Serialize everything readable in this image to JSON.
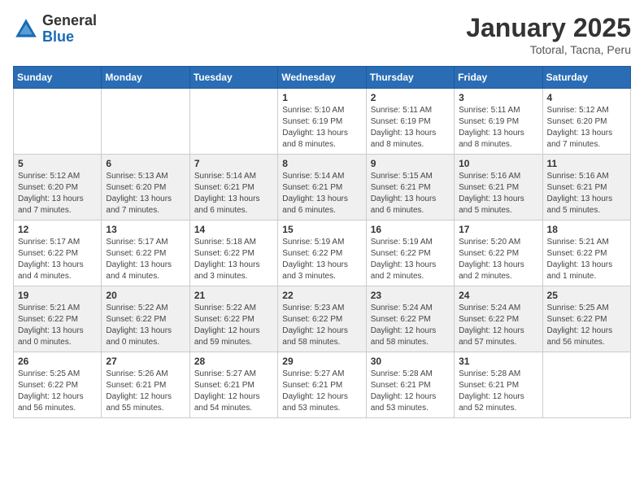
{
  "header": {
    "logo_general": "General",
    "logo_blue": "Blue",
    "title": "January 2025",
    "location": "Totoral, Tacna, Peru"
  },
  "calendar": {
    "days_of_week": [
      "Sunday",
      "Monday",
      "Tuesday",
      "Wednesday",
      "Thursday",
      "Friday",
      "Saturday"
    ],
    "weeks": [
      [
        {
          "day": "",
          "info": ""
        },
        {
          "day": "",
          "info": ""
        },
        {
          "day": "",
          "info": ""
        },
        {
          "day": "1",
          "info": "Sunrise: 5:10 AM\nSunset: 6:19 PM\nDaylight: 13 hours and 8 minutes."
        },
        {
          "day": "2",
          "info": "Sunrise: 5:11 AM\nSunset: 6:19 PM\nDaylight: 13 hours and 8 minutes."
        },
        {
          "day": "3",
          "info": "Sunrise: 5:11 AM\nSunset: 6:19 PM\nDaylight: 13 hours and 8 minutes."
        },
        {
          "day": "4",
          "info": "Sunrise: 5:12 AM\nSunset: 6:20 PM\nDaylight: 13 hours and 7 minutes."
        }
      ],
      [
        {
          "day": "5",
          "info": "Sunrise: 5:12 AM\nSunset: 6:20 PM\nDaylight: 13 hours and 7 minutes."
        },
        {
          "day": "6",
          "info": "Sunrise: 5:13 AM\nSunset: 6:20 PM\nDaylight: 13 hours and 7 minutes."
        },
        {
          "day": "7",
          "info": "Sunrise: 5:14 AM\nSunset: 6:21 PM\nDaylight: 13 hours and 6 minutes."
        },
        {
          "day": "8",
          "info": "Sunrise: 5:14 AM\nSunset: 6:21 PM\nDaylight: 13 hours and 6 minutes."
        },
        {
          "day": "9",
          "info": "Sunrise: 5:15 AM\nSunset: 6:21 PM\nDaylight: 13 hours and 6 minutes."
        },
        {
          "day": "10",
          "info": "Sunrise: 5:16 AM\nSunset: 6:21 PM\nDaylight: 13 hours and 5 minutes."
        },
        {
          "day": "11",
          "info": "Sunrise: 5:16 AM\nSunset: 6:21 PM\nDaylight: 13 hours and 5 minutes."
        }
      ],
      [
        {
          "day": "12",
          "info": "Sunrise: 5:17 AM\nSunset: 6:22 PM\nDaylight: 13 hours and 4 minutes."
        },
        {
          "day": "13",
          "info": "Sunrise: 5:17 AM\nSunset: 6:22 PM\nDaylight: 13 hours and 4 minutes."
        },
        {
          "day": "14",
          "info": "Sunrise: 5:18 AM\nSunset: 6:22 PM\nDaylight: 13 hours and 3 minutes."
        },
        {
          "day": "15",
          "info": "Sunrise: 5:19 AM\nSunset: 6:22 PM\nDaylight: 13 hours and 3 minutes."
        },
        {
          "day": "16",
          "info": "Sunrise: 5:19 AM\nSunset: 6:22 PM\nDaylight: 13 hours and 2 minutes."
        },
        {
          "day": "17",
          "info": "Sunrise: 5:20 AM\nSunset: 6:22 PM\nDaylight: 13 hours and 2 minutes."
        },
        {
          "day": "18",
          "info": "Sunrise: 5:21 AM\nSunset: 6:22 PM\nDaylight: 13 hours and 1 minute."
        }
      ],
      [
        {
          "day": "19",
          "info": "Sunrise: 5:21 AM\nSunset: 6:22 PM\nDaylight: 13 hours and 0 minutes."
        },
        {
          "day": "20",
          "info": "Sunrise: 5:22 AM\nSunset: 6:22 PM\nDaylight: 13 hours and 0 minutes."
        },
        {
          "day": "21",
          "info": "Sunrise: 5:22 AM\nSunset: 6:22 PM\nDaylight: 12 hours and 59 minutes."
        },
        {
          "day": "22",
          "info": "Sunrise: 5:23 AM\nSunset: 6:22 PM\nDaylight: 12 hours and 58 minutes."
        },
        {
          "day": "23",
          "info": "Sunrise: 5:24 AM\nSunset: 6:22 PM\nDaylight: 12 hours and 58 minutes."
        },
        {
          "day": "24",
          "info": "Sunrise: 5:24 AM\nSunset: 6:22 PM\nDaylight: 12 hours and 57 minutes."
        },
        {
          "day": "25",
          "info": "Sunrise: 5:25 AM\nSunset: 6:22 PM\nDaylight: 12 hours and 56 minutes."
        }
      ],
      [
        {
          "day": "26",
          "info": "Sunrise: 5:25 AM\nSunset: 6:22 PM\nDaylight: 12 hours and 56 minutes."
        },
        {
          "day": "27",
          "info": "Sunrise: 5:26 AM\nSunset: 6:21 PM\nDaylight: 12 hours and 55 minutes."
        },
        {
          "day": "28",
          "info": "Sunrise: 5:27 AM\nSunset: 6:21 PM\nDaylight: 12 hours and 54 minutes."
        },
        {
          "day": "29",
          "info": "Sunrise: 5:27 AM\nSunset: 6:21 PM\nDaylight: 12 hours and 53 minutes."
        },
        {
          "day": "30",
          "info": "Sunrise: 5:28 AM\nSunset: 6:21 PM\nDaylight: 12 hours and 53 minutes."
        },
        {
          "day": "31",
          "info": "Sunrise: 5:28 AM\nSunset: 6:21 PM\nDaylight: 12 hours and 52 minutes."
        },
        {
          "day": "",
          "info": ""
        }
      ]
    ]
  }
}
